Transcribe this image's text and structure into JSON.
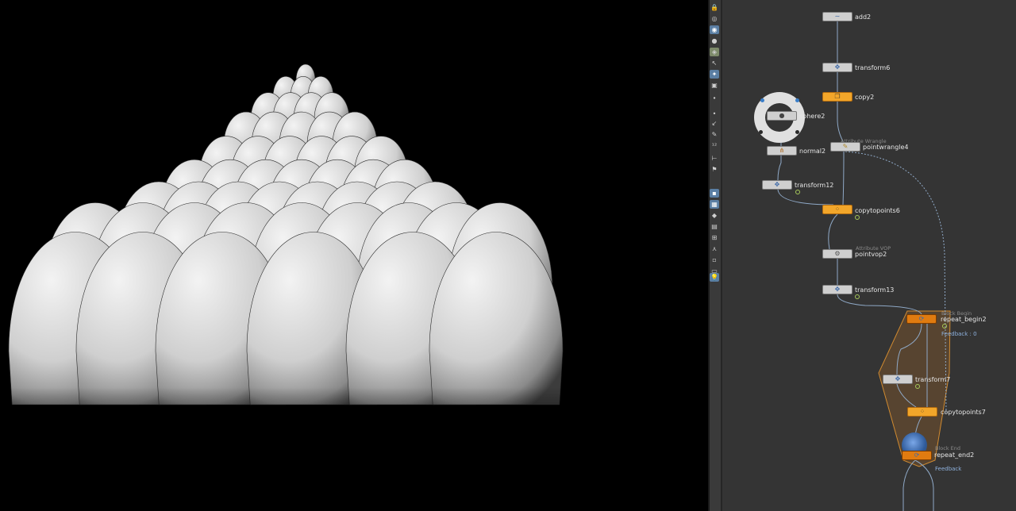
{
  "viewport": {
    "scene": "copied-spheres-pyramid",
    "background_color": "#000000",
    "object_color": "#d9d9d9"
  },
  "toolbar": {
    "icons": [
      "lock-icon",
      "target-icon",
      "view-icon",
      "light-icon",
      "camera-icon",
      "pick-icon",
      "snap-icon",
      "wire-icon",
      "dots-icon",
      "point-icon",
      "arrow-icon",
      "pen-icon",
      "count-icon",
      "axis-icon",
      "flag-icon",
      "display-icon",
      "checker-icon",
      "shade-icon",
      "texture-icon",
      "grid-icon",
      "axes-icon",
      "box-icon",
      "screen-icon",
      "bulb-icon"
    ]
  },
  "network": {
    "colors": {
      "wire": "#8fa9c7",
      "selected": "#f2a62a",
      "block": "#e07b10",
      "flag": "#a7c95a",
      "feedback": "#8fb2de"
    },
    "nodes": {
      "add2": {
        "label": "add2"
      },
      "transform6": {
        "label": "transform6"
      },
      "copy2": {
        "label": "copy2"
      },
      "sphere2": {
        "label": "sphere2"
      },
      "normal2": {
        "label": "normal2"
      },
      "pointwrangle4": {
        "label": "pointwrangle4",
        "sub": "Attribute Wrangle"
      },
      "transform12": {
        "label": "transform12"
      },
      "copytopoints6": {
        "label": "copytopoints6"
      },
      "pointvop2": {
        "label": "pointvop2",
        "sub": "Attribute VOP"
      },
      "transform13": {
        "label": "transform13"
      },
      "repeat_begin2": {
        "label": "repeat_begin2",
        "sub": "Block Begin",
        "feedback": "Feedback : 0"
      },
      "transform7": {
        "label": "transform7"
      },
      "copytopoints7": {
        "label": "copytopoints7"
      },
      "repeat_end2": {
        "label": "repeat_end2",
        "sub": "Block End",
        "feedback": "Feedback"
      }
    }
  }
}
